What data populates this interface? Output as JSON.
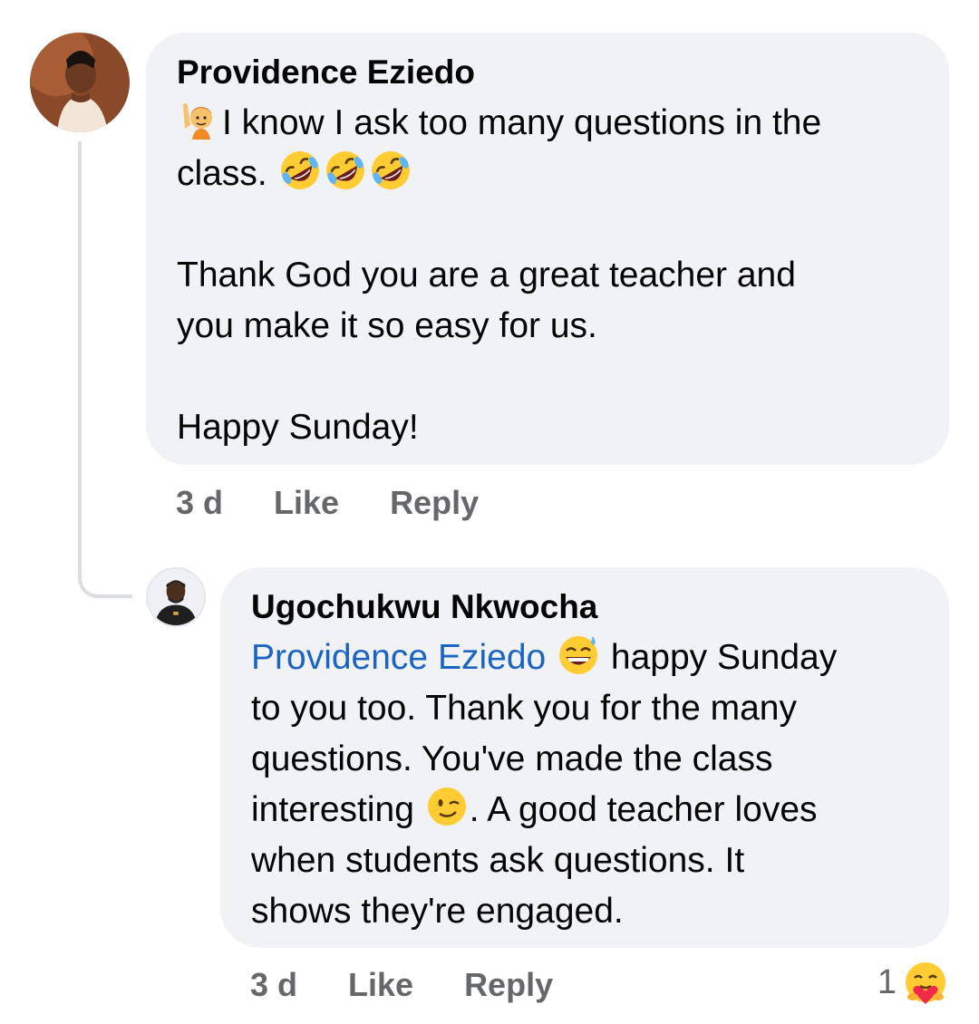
{
  "comments": [
    {
      "author": "Providence Eziedo",
      "avatar_icon": "woman-portrait-avatar",
      "line1": "I know I ask too many questions in the",
      "line2": "class. ",
      "paragraph2": "Thank God you are a great teacher and\nyou make it so easy for us.",
      "paragraph3": "Happy Sunday!",
      "time": "3 d",
      "like_label": "Like",
      "reply_label": "Reply"
    },
    {
      "author": "Ugochukwu Nkwocha",
      "avatar_icon": "man-portrait-avatar",
      "mention": "Providence Eziedo",
      "text_a": " happy Sunday\nto you too. Thank you for the many\nquestions. You've made the class\ninteresting ",
      "text_b": ". A good teacher loves\nwhen students ask questions. It\nshows they're engaged.",
      "time": "3 d",
      "like_label": "Like",
      "reply_label": "Reply",
      "reaction_count": "1",
      "reaction_icon": "care-reaction-icon"
    }
  ],
  "colors": {
    "bubble": "#f0f2f5",
    "mention": "#1b64c4",
    "meta": "#65676b",
    "thread_line": "#dcdde0"
  }
}
